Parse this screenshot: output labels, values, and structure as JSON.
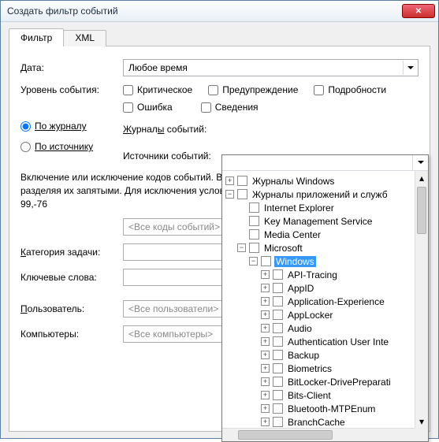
{
  "window": {
    "title": "Создать фильтр событий"
  },
  "tabs": {
    "filter": "Фильтр",
    "xml": "XML"
  },
  "labels": {
    "date": "Дата:",
    "level": "Уровень события:",
    "by_log": "По журналу",
    "by_source": "По источнику",
    "event_logs": "Журналы событий:",
    "event_sources": "Источники событий:",
    "category": "Категория задачи:",
    "keywords": "Ключевые слова:",
    "user": "Пользователь:",
    "computers": "Компьютеры:"
  },
  "date_combo": "Любое время",
  "levels": {
    "critical": "Критическое",
    "warning": "Предупреждение",
    "verbose": "Подробности",
    "error": "Ошибка",
    "info": "Сведения"
  },
  "desc": "Включение или исключение кодов событий. Введите коды событий или диапазоны кодов, разделяя их запятыми. Для исключения условия введите знак минус. Например: 1,3,5-99,-76",
  "codes_placeholder": "<Все коды событий>",
  "user_placeholder": "<Все пользователи>",
  "computers_placeholder": "<Все компьютеры>",
  "tree": [
    {
      "d": 0,
      "t": "+",
      "label": "Журналы Windows"
    },
    {
      "d": 0,
      "t": "-",
      "label": "Журналы приложений и служб"
    },
    {
      "d": 1,
      "t": "",
      "label": "Internet Explorer"
    },
    {
      "d": 1,
      "t": "",
      "label": "Key Management Service"
    },
    {
      "d": 1,
      "t": "",
      "label": "Media Center"
    },
    {
      "d": 1,
      "t": "-",
      "label": "Microsoft"
    },
    {
      "d": 2,
      "t": "-",
      "label": "Windows",
      "sel": true
    },
    {
      "d": 3,
      "t": "+",
      "label": "API-Tracing"
    },
    {
      "d": 3,
      "t": "+",
      "label": "AppID"
    },
    {
      "d": 3,
      "t": "+",
      "label": "Application-Experience"
    },
    {
      "d": 3,
      "t": "+",
      "label": "AppLocker"
    },
    {
      "d": 3,
      "t": "+",
      "label": "Audio"
    },
    {
      "d": 3,
      "t": "+",
      "label": "Authentication User Inte"
    },
    {
      "d": 3,
      "t": "+",
      "label": "Backup"
    },
    {
      "d": 3,
      "t": "+",
      "label": "Biometrics"
    },
    {
      "d": 3,
      "t": "+",
      "label": "BitLocker-DrivePreparati"
    },
    {
      "d": 3,
      "t": "+",
      "label": "Bits-Client"
    },
    {
      "d": 3,
      "t": "+",
      "label": "Bluetooth-MTPEnum"
    },
    {
      "d": 3,
      "t": "+",
      "label": "BranchCache"
    }
  ]
}
